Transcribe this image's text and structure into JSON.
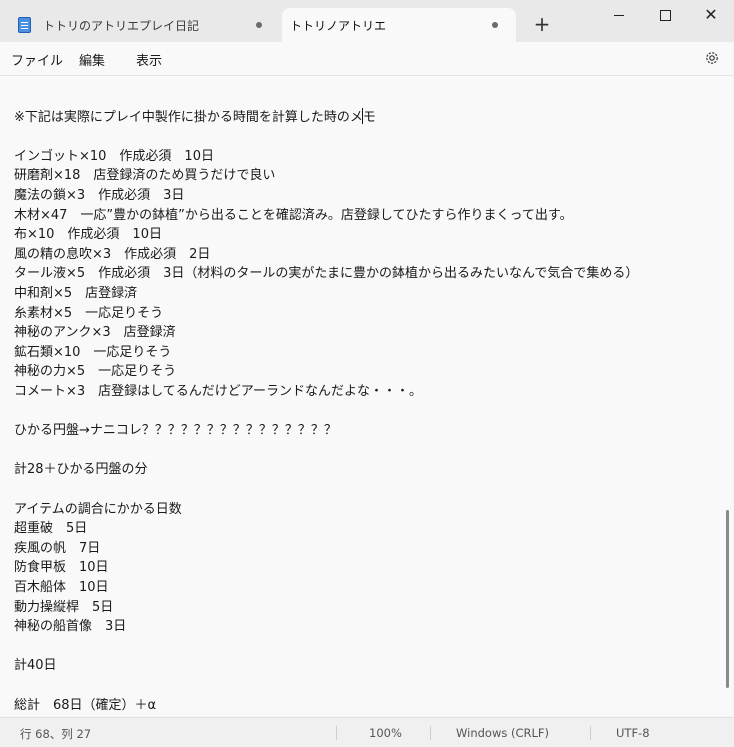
{
  "tabs": [
    {
      "title": "トトリのアトリエプレイ日記",
      "unsaved": true,
      "active": false
    },
    {
      "title": "トトリノアトリエ",
      "unsaved": true,
      "active": true
    }
  ],
  "new_tab_label": "+",
  "menu": {
    "file": "ファイル",
    "edit": "編集",
    "view": "表示"
  },
  "editor": {
    "lines": [
      "",
      "※下記は実際にプレイ中製作に掛かる時間を計算した時のメモ",
      "",
      "インゴット×10　作成必須　10日",
      "研磨剤×18　店登録済のため買うだけで良い",
      "魔法の鎖×3　作成必須　3日",
      "木材×47　一応”豊かの鉢植”から出ることを確認済み。店登録してひたすら作りまくって出す。",
      "布×10　作成必須　10日",
      "風の精の息吹×3　作成必須　2日",
      "タール液×5　作成必須　3日（材料のタールの実がたまに豊かの鉢植から出るみたいなんで気合で集める）",
      "中和剤×5　店登録済",
      "糸素材×5　一応足りそう",
      "神秘のアンク×3　店登録済",
      "鉱石類×10　一応足りそう",
      "神秘の力×5　一応足りそう",
      "コメート×3　店登録はしてるんだけどアーランドなんだよな・・・。",
      "",
      "ひかる円盤→ナニコレ？？？？？？？？？？？？？？？",
      "",
      "計28＋ひかる円盤の分",
      "",
      "アイテムの調合にかかる日数",
      "超重破　5日",
      "疾風の帆　7日",
      "防食甲板　10日",
      "百木船体　10日",
      "動力操縦桿　5日",
      "神秘の船首像　3日",
      "",
      "計40日",
      "",
      "総計　68日（確定）＋α"
    ]
  },
  "status": {
    "position": "行 68、列 27",
    "zoom": "100%",
    "line_ending": "Windows (CRLF)",
    "encoding": "UTF-8"
  },
  "icons": {
    "app": "notepad-icon",
    "settings": "gear-icon",
    "minimize": "minimize-icon",
    "maximize": "maximize-icon",
    "close": "close-icon"
  }
}
